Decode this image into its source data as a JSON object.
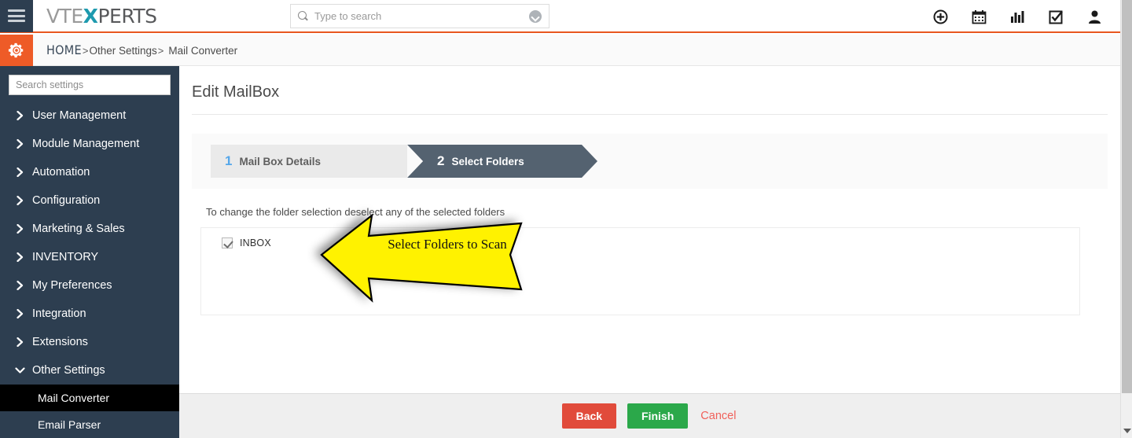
{
  "topbar": {
    "menu_icon": "hamburger-icon",
    "logo": {
      "part1": "VTE",
      "part2": "X",
      "part3": "PERTS"
    },
    "search": {
      "placeholder": "Type to search",
      "value": "",
      "icon": "search-icon",
      "dropdown_icon": "chevron-down-circle-icon"
    },
    "icons": [
      {
        "name": "add-circle-icon",
        "label": "Add"
      },
      {
        "name": "calendar-icon",
        "label": "Calendar"
      },
      {
        "name": "chart-bar-icon",
        "label": "Reports"
      },
      {
        "name": "checkbox-task-icon",
        "label": "Tasks"
      },
      {
        "name": "user-profile-icon",
        "label": "Profile"
      }
    ]
  },
  "breadcrumb": {
    "gear_icon": "gear-icon",
    "home": "HOME",
    "sep1": ">",
    "item1": "Other Settings",
    "sep2": ">",
    "item2": "Mail Converter"
  },
  "sidebar": {
    "search_placeholder": "Search settings",
    "search_value": "",
    "items": [
      {
        "label": "User Management",
        "icon": "chevron-right-icon",
        "expanded": false
      },
      {
        "label": "Module Management",
        "icon": "chevron-right-icon",
        "expanded": false
      },
      {
        "label": "Automation",
        "icon": "chevron-right-icon",
        "expanded": false
      },
      {
        "label": "Configuration",
        "icon": "chevron-right-icon",
        "expanded": false
      },
      {
        "label": "Marketing & Sales",
        "icon": "chevron-right-icon",
        "expanded": false
      },
      {
        "label": "INVENTORY",
        "icon": "chevron-right-icon",
        "expanded": false
      },
      {
        "label": "My Preferences",
        "icon": "chevron-right-icon",
        "expanded": false
      },
      {
        "label": "Integration",
        "icon": "chevron-right-icon",
        "expanded": false
      },
      {
        "label": "Extensions",
        "icon": "chevron-right-icon",
        "expanded": false
      },
      {
        "label": "Other Settings",
        "icon": "chevron-down-icon",
        "expanded": true
      }
    ],
    "subitems": [
      {
        "label": "Mail Converter",
        "active": true
      },
      {
        "label": "Email Parser",
        "active": false
      }
    ]
  },
  "main": {
    "page_title": "Edit MailBox",
    "steps": [
      {
        "num": "1",
        "label": "Mail Box Details",
        "state": "inactive"
      },
      {
        "num": "2",
        "label": "Select Folders",
        "state": "active"
      }
    ],
    "hint": "To change the folder selection deselect any of the selected folders",
    "folders": [
      {
        "label": "INBOX",
        "checked": true
      }
    ]
  },
  "annotation": {
    "text": "Select Folders to Scan",
    "shape": "left-arrow",
    "fill": "#FFF200",
    "stroke": "#000000"
  },
  "footer": {
    "back_label": "Back",
    "finish_label": "Finish",
    "cancel_label": "Cancel"
  },
  "colors": {
    "sidebar_bg": "#2D3E50",
    "accent_orange": "#EE5B27",
    "step_active": "#546270",
    "step_inactive": "#EAEAEA",
    "back_red": "#E14B3B",
    "finish_green": "#2BA84A",
    "cancel_red": "#F0605A",
    "annot_yellow": "#FFF200"
  }
}
